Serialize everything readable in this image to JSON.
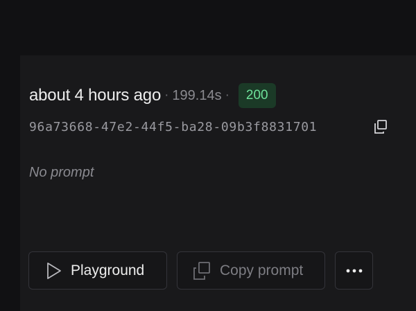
{
  "run": {
    "time_ago": "about 4 hours ago",
    "separator": "·",
    "duration": "199.14s",
    "status_code": "200",
    "id": "96a73668-47e2-44f5-ba28-09b3f8831701",
    "prompt_placeholder": "No prompt"
  },
  "actions": {
    "playground_label": "Playground",
    "copy_prompt_label": "Copy prompt",
    "more_label": "···"
  },
  "colors": {
    "background": "#111113",
    "card": "#19191b",
    "status_bg": "#1b3a27",
    "status_text": "#6ee29a"
  },
  "icons": {
    "copy_id": "copy-icon",
    "playground": "play-icon",
    "copy_prompt": "copy-icon",
    "more": "more-horizontal-icon"
  }
}
